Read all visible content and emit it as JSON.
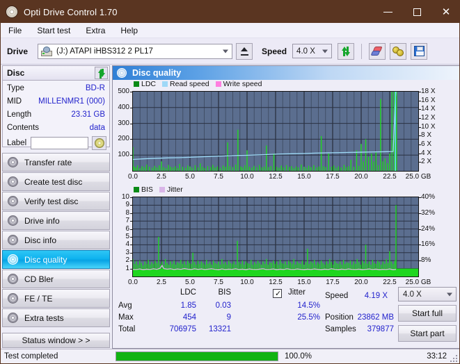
{
  "window": {
    "title": "Opti Drive Control 1.70",
    "icon": "disc-icon",
    "minimize": "minimize-icon",
    "maximize": "maximize-icon",
    "close": "close-icon",
    "titlebar_color": "#5a3521"
  },
  "menu": {
    "items": [
      {
        "label": "File"
      },
      {
        "label": "Start test"
      },
      {
        "label": "Extra"
      },
      {
        "label": "Help"
      }
    ]
  },
  "toolbar": {
    "drive_label": "Drive",
    "drive_value": "(J:)   ATAPI iHBS312   2 PL17",
    "eject_icon": "eject-icon",
    "speed_label": "Speed",
    "speed_value": "4.0 X",
    "refresh_icon": "refresh-icon",
    "eraser_icon": "eraser-icon",
    "cymbal_icon": "cymbal-icon",
    "save_icon": "save-icon"
  },
  "disc": {
    "header": "Disc",
    "refresh_icon": "refresh-icon",
    "rows": [
      {
        "key": "Type",
        "value": "BD-R"
      },
      {
        "key": "MID",
        "value": "MILLENMR1 (000)"
      },
      {
        "key": "Length",
        "value": "23.31 GB"
      },
      {
        "key": "Contents",
        "value": "data"
      }
    ],
    "label_key": "Label",
    "label_value": "",
    "label_button_icon": "cd-icon"
  },
  "sidebar": {
    "items": [
      {
        "label": "Transfer rate",
        "icon": "disc-icon",
        "active": false
      },
      {
        "label": "Create test disc",
        "icon": "disc-icon",
        "active": false
      },
      {
        "label": "Verify test disc",
        "icon": "disc-icon",
        "active": false
      },
      {
        "label": "Drive info",
        "icon": "disc-icon",
        "active": false
      },
      {
        "label": "Disc info",
        "icon": "disc-icon",
        "active": false
      },
      {
        "label": "Disc quality",
        "icon": "disc-icon",
        "active": true
      },
      {
        "label": "CD Bler",
        "icon": "disc-icon",
        "active": false
      },
      {
        "label": "FE / TE",
        "icon": "disc-icon",
        "active": false
      },
      {
        "label": "Extra tests",
        "icon": "disc-icon",
        "active": false
      }
    ],
    "status_window_label": "Status window > >"
  },
  "main": {
    "header_title": "Disc quality",
    "header_icon": "disc-icon"
  },
  "stats": {
    "col_ldc": "LDC",
    "col_bis": "BIS",
    "jitter_label": "Jitter",
    "jitter_checked": true,
    "row_avg": "Avg",
    "row_max": "Max",
    "row_total": "Total",
    "avg_ldc": "1.85",
    "avg_bis": "0.03",
    "avg_jitter": "14.5%",
    "max_ldc": "454",
    "max_bis": "9",
    "max_jitter": "25.5%",
    "total_ldc": "706975",
    "total_bis": "13321",
    "speed_label": "Speed",
    "speed_value": "4.19 X",
    "position_label": "Position",
    "position_value": "23862 MB",
    "samples_label": "Samples",
    "samples_value": "379877",
    "speed_select": "4.0 X",
    "start_full": "Start full",
    "start_part": "Start part"
  },
  "statusbar": {
    "message": "Test completed",
    "percent": "100.0%",
    "progress_value": 100,
    "elapsed": "33:12"
  },
  "chart_data": [
    {
      "type": "line",
      "name": "ldc-chart",
      "title": "Disc quality - LDC",
      "xlabel": "GB",
      "ylabel": "LDC",
      "xlim": [
        0,
        25.0
      ],
      "ylim": [
        0,
        500
      ],
      "y2lim": [
        0,
        18
      ],
      "y2label": "X",
      "xticks": [
        "0.0",
        "2.5",
        "5.0",
        "7.5",
        "10.0",
        "12.5",
        "15.0",
        "17.5",
        "20.0",
        "22.5",
        "25.0 GB"
      ],
      "yticks": [
        500,
        400,
        300,
        200,
        100
      ],
      "y2ticks": [
        "18 X",
        "16 X",
        "14 X",
        "12 X",
        "10 X",
        "8 X",
        "6 X",
        "4 X",
        "2 X"
      ],
      "grid": true,
      "legend": [
        {
          "label": "LDC",
          "color": "#0a8a16"
        },
        {
          "label": "Read speed",
          "color": "#9fd8f7"
        },
        {
          "label": "Write speed",
          "color": "#ff7fe0"
        }
      ],
      "series": [
        {
          "name": "LDC",
          "color": "#1fd61f",
          "style": "impulse",
          "x": [
            0.0,
            0.1,
            0.25,
            0.4,
            0.6,
            0.8,
            1.0,
            1.2,
            1.45,
            1.7,
            1.9,
            2.1,
            2.3,
            2.5,
            2.7,
            2.9,
            3.1,
            3.3,
            3.5,
            3.7,
            3.9,
            4.1,
            4.35,
            4.6,
            4.8,
            5.0,
            5.2,
            5.45,
            5.7,
            5.9,
            6.1,
            6.3,
            6.55,
            6.8,
            7.0,
            7.2,
            7.4,
            7.65,
            7.9,
            8.1,
            8.3,
            8.5,
            8.75,
            9.0,
            9.2,
            9.45,
            9.6,
            9.8,
            10.0,
            10.2,
            10.4,
            10.6,
            10.85,
            11.1,
            11.3,
            11.5,
            11.7,
            11.9,
            12.1,
            12.35,
            12.6,
            12.8,
            13.0,
            13.2,
            13.45,
            13.7,
            13.9,
            14.1,
            14.3,
            14.5,
            14.75,
            15.0,
            15.2,
            15.4,
            15.6,
            15.85,
            16.1,
            16.3,
            16.5,
            16.7,
            16.9,
            17.15,
            17.4,
            17.6,
            17.8,
            18.0,
            18.25,
            18.5,
            18.7,
            18.9,
            19.1,
            19.35,
            19.6,
            19.8,
            20.0,
            20.2,
            20.4,
            20.65,
            20.9,
            21.1,
            21.3,
            21.5,
            21.7,
            21.9,
            22.1,
            22.3,
            22.5,
            22.7,
            22.9,
            23.0,
            23.1
          ],
          "y": [
            150,
            28,
            22,
            35,
            18,
            30,
            24,
            40,
            26,
            20,
            32,
            22,
            35,
            60,
            24,
            18,
            38,
            26,
            22,
            30,
            18,
            44,
            26,
            20,
            34,
            28,
            20,
            36,
            22,
            48,
            26,
            18,
            30,
            24,
            38,
            22,
            28,
            20,
            34,
            26,
            180,
            30,
            24,
            40,
            260,
            28,
            22,
            36,
            130,
            26,
            20,
            32,
            24,
            38,
            22,
            28,
            160,
            24,
            30,
            110,
            26,
            20,
            34,
            22,
            36,
            24,
            30,
            18,
            28,
            22,
            40,
            26,
            20,
            32,
            24,
            36,
            22,
            28,
            220,
            30,
            24,
            110,
            26,
            34,
            20,
            28,
            22,
            38,
            24,
            30,
            70,
            26,
            130,
            32,
            170,
            60,
            200,
            90,
            110,
            60,
            120,
            36,
            454,
            60,
            80,
            48,
            110
          ]
        },
        {
          "name": "Read speed",
          "color": "#9fdcf8",
          "style": "line",
          "x": [
            0.0,
            1.0,
            2.0,
            3.0,
            4.0,
            5.0,
            6.0,
            7.0,
            8.0,
            9.0,
            10.0,
            11.0,
            12.0,
            13.0,
            14.0,
            15.0,
            16.0,
            17.0,
            18.0,
            19.0,
            20.0,
            21.0,
            22.0,
            22.8,
            23.0,
            23.05
          ],
          "y": [
            2.6,
            2.75,
            2.85,
            2.95,
            3.0,
            3.1,
            3.2,
            3.3,
            3.4,
            3.5,
            3.55,
            3.65,
            3.75,
            3.85,
            3.9,
            3.95,
            4.05,
            4.1,
            4.15,
            4.2,
            4.25,
            4.3,
            4.35,
            4.4,
            16.5,
            18.0
          ]
        }
      ]
    },
    {
      "type": "line",
      "name": "bis-chart",
      "title": "Disc quality - BIS",
      "xlabel": "GB",
      "ylabel": "BIS",
      "xlim": [
        0,
        25.0
      ],
      "ylim": [
        0,
        10
      ],
      "y2lim": [
        0,
        40
      ],
      "y2label": "%",
      "xticks": [
        "0.0",
        "2.5",
        "5.0",
        "7.5",
        "10.0",
        "12.5",
        "15.0",
        "17.5",
        "20.0",
        "22.5",
        "25.0 GB"
      ],
      "yticks": [
        10,
        9,
        8,
        7,
        6,
        5,
        4,
        3,
        2,
        1
      ],
      "y2ticks": [
        "40%",
        "32%",
        "24%",
        "16%",
        "8%"
      ],
      "grid": true,
      "legend": [
        {
          "label": "BIS",
          "color": "#0a8a16"
        },
        {
          "label": "Jitter",
          "color": "#d9b6e8"
        }
      ],
      "series": [
        {
          "name": "BIS",
          "color": "#1fd61f",
          "style": "impulse",
          "baseline": 1.0,
          "x": [
            0.0,
            0.15,
            0.3,
            0.45,
            0.6,
            0.75,
            0.9,
            1.05,
            1.2,
            1.35,
            1.5,
            1.65,
            1.8,
            1.95,
            2.1,
            2.25,
            2.4,
            2.55,
            2.7,
            2.85,
            3.0,
            3.15,
            3.3,
            3.45,
            3.6,
            3.75,
            3.9,
            4.05,
            4.2,
            4.35,
            4.5,
            4.65,
            4.8,
            4.95,
            5.1,
            5.25,
            5.4,
            5.55,
            5.7,
            5.85,
            6.0,
            6.15,
            6.3,
            6.45,
            6.6,
            6.75,
            6.9,
            7.05,
            7.2,
            7.35,
            7.5,
            7.65,
            7.8,
            7.95,
            8.1,
            8.25,
            8.4,
            8.55,
            8.7,
            8.85,
            9.0,
            9.15,
            9.3,
            9.45,
            9.6,
            9.75,
            9.9,
            10.05,
            10.2,
            10.35,
            10.5,
            10.65,
            10.8,
            10.95,
            11.1,
            11.25,
            11.4,
            11.55,
            11.7,
            11.85,
            12.0,
            12.15,
            12.3,
            12.45,
            12.6,
            12.75,
            12.9,
            13.05,
            13.2,
            13.35,
            13.5,
            13.65,
            13.8,
            13.95,
            14.1,
            14.25,
            14.4,
            14.55,
            14.7,
            14.85,
            15.0,
            15.15,
            15.3,
            15.45,
            15.6,
            15.75,
            15.9,
            16.05,
            16.2,
            16.35,
            16.5,
            16.65,
            16.8,
            16.95,
            17.1,
            17.25,
            17.4,
            17.55,
            17.7,
            17.85,
            18.0,
            18.15,
            18.3,
            18.45,
            18.6,
            18.75,
            18.9,
            19.05,
            19.2,
            19.35,
            19.5,
            19.65,
            19.8,
            19.95,
            20.1,
            20.25,
            20.4,
            20.55,
            20.7,
            20.85,
            21.0,
            21.15,
            21.3,
            21.45,
            21.6,
            21.75,
            21.9,
            22.05,
            22.2,
            22.35,
            22.5,
            22.65,
            22.8,
            22.95,
            23.05
          ],
          "y": [
            2.2,
            1.6,
            1.9,
            1.5,
            2.0,
            1.7,
            1.4,
            1.9,
            1.6,
            2.1,
            1.5,
            1.8,
            1.6,
            2.0,
            1.7,
            5.0,
            1.6,
            1.9,
            1.5,
            2.2,
            1.7,
            1.5,
            1.9,
            1.6,
            2.0,
            1.5,
            1.8,
            1.7,
            2.1,
            1.6,
            1.9,
            1.5,
            2.0,
            1.7,
            1.6,
            3.0,
            1.8,
            1.5,
            2.0,
            1.6,
            1.9,
            1.7,
            1.5,
            2.1,
            1.6,
            1.8,
            1.5,
            2.0,
            1.7,
            1.6,
            1.9,
            1.5,
            2.2,
            1.6,
            1.8,
            1.5,
            2.0,
            1.7,
            1.6,
            1.9,
            1.5,
            4.5,
            1.8,
            1.6,
            2.0,
            1.5,
            1.9,
            1.7,
            1.6,
            2.1,
            1.5,
            1.8,
            1.6,
            2.0,
            1.7,
            1.5,
            1.9,
            1.6,
            2.2,
            1.5,
            1.8,
            1.7,
            2.0,
            1.6,
            1.9,
            1.5,
            2.1,
            1.7,
            1.6,
            1.9,
            1.5,
            2.0,
            1.8,
            1.6,
            2.2,
            1.5,
            1.9,
            1.7,
            1.6,
            2.0,
            1.5,
            1.8,
            3.5,
            1.6,
            1.9,
            1.7,
            2.1,
            1.5,
            1.8,
            1.6,
            2.0,
            1.7,
            1.5,
            1.9,
            1.6,
            2.2,
            1.8,
            1.5,
            2.0,
            1.7,
            1.6,
            1.9,
            1.5,
            2.1,
            1.6,
            1.8,
            1.7,
            2.0,
            1.5,
            1.9,
            1.6,
            2.2,
            1.8,
            1.5,
            2.0,
            1.7,
            4.0,
            1.6,
            1.9,
            1.5,
            2.1,
            1.7,
            1.6,
            2.0,
            1.8,
            1.5,
            1.9,
            1.6,
            2.2,
            1.7,
            3.2,
            1.9,
            1.6,
            2.0,
            9.0,
            2.4
          ]
        },
        {
          "name": "Jitter",
          "color": "#dbb4e6",
          "style": "line",
          "x": [
            0.0,
            0.3,
            0.6,
            0.9,
            1.2,
            1.5,
            1.8,
            2.1,
            2.4,
            2.55,
            2.7,
            3.0,
            3.3,
            3.6,
            3.9,
            4.2,
            4.5,
            4.8,
            5.1,
            5.4,
            5.7,
            6.0,
            6.3,
            6.6,
            6.9,
            7.2,
            7.5,
            7.8,
            8.1,
            8.4,
            8.7,
            9.0,
            9.3,
            9.6,
            9.9,
            10.2,
            10.5,
            10.8,
            11.1,
            11.4,
            11.7,
            12.0,
            12.3,
            12.6,
            12.9,
            13.2,
            13.5,
            13.8,
            14.1,
            14.4,
            14.7,
            15.0,
            15.3,
            15.6,
            15.9,
            16.2,
            16.5,
            16.8,
            17.1,
            17.4,
            17.7,
            18.0,
            18.3,
            18.6,
            18.9,
            19.2,
            19.5,
            19.8,
            20.1,
            20.4,
            20.7,
            21.0,
            21.3,
            21.6,
            21.9,
            22.2,
            22.5,
            22.8,
            23.05
          ],
          "y": [
            3.6,
            3.5,
            3.8,
            3.4,
            3.7,
            3.5,
            3.9,
            3.6,
            4.2,
            5.6,
            4.0,
            3.7,
            3.9,
            3.5,
            3.8,
            3.6,
            4.0,
            3.7,
            3.5,
            3.9,
            3.6,
            3.8,
            3.5,
            3.7,
            3.9,
            3.6,
            3.4,
            3.8,
            3.5,
            3.7,
            3.6,
            3.9,
            3.5,
            3.7,
            3.4,
            3.8,
            3.6,
            3.5,
            3.7,
            3.9,
            3.5,
            3.6,
            3.8,
            3.4,
            3.7,
            3.5,
            3.9,
            3.6,
            3.5,
            3.8,
            3.6,
            3.4,
            3.7,
            3.5,
            3.8,
            3.6,
            3.4,
            3.7,
            3.5,
            3.9,
            3.6,
            3.4,
            3.7,
            3.5,
            3.8,
            3.6,
            3.5,
            3.7,
            3.4,
            3.6,
            3.8,
            3.5,
            3.7,
            3.4,
            3.6,
            3.5,
            3.8,
            3.4,
            3.6
          ]
        }
      ]
    }
  ]
}
